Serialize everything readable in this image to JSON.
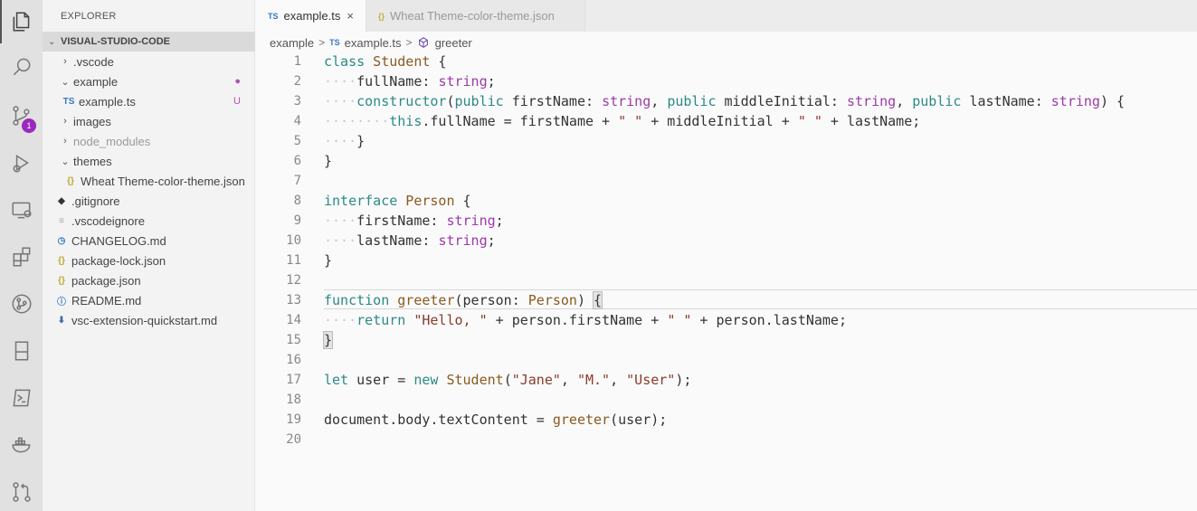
{
  "activity_bar": {
    "items": [
      {
        "icon": "files-icon",
        "active": true
      },
      {
        "icon": "search-icon"
      },
      {
        "icon": "source-control-icon",
        "badge": "1"
      },
      {
        "icon": "run-debug-icon"
      },
      {
        "icon": "remote-explorer-icon"
      },
      {
        "icon": "extensions-icon"
      },
      {
        "icon": "git-graph-icon"
      },
      {
        "icon": "bookmark-icon"
      },
      {
        "icon": "terminal-icon"
      },
      {
        "icon": "docker-icon"
      },
      {
        "icon": "pull-request-icon"
      }
    ]
  },
  "sidebar": {
    "title": "EXPLORER",
    "section": "VISUAL-STUDIO-CODE",
    "tree": [
      {
        "label": ".vscode",
        "twisty": "›",
        "indent": 1,
        "icon": ""
      },
      {
        "label": "example",
        "twisty": "⌄",
        "indent": 1,
        "icon": "",
        "decoration": "●",
        "modified": true
      },
      {
        "label": "example.ts",
        "twisty": "",
        "indent": 1,
        "icon": "TS",
        "decoration": "U",
        "modified": true
      },
      {
        "label": "images",
        "twisty": "›",
        "indent": 1,
        "icon": ""
      },
      {
        "label": "node_modules",
        "twisty": "›",
        "indent": 1,
        "icon": "",
        "dim": true
      },
      {
        "label": "themes",
        "twisty": "⌄",
        "indent": 1,
        "icon": ""
      },
      {
        "label": "Wheat Theme-color-theme.json",
        "twisty": "",
        "indent": 2,
        "icon": "{}"
      },
      {
        "label": ".gitignore",
        "twisty": "",
        "indent": 0,
        "icon": "◆"
      },
      {
        "label": ".vscodeignore",
        "twisty": "",
        "indent": 0,
        "icon": "≡"
      },
      {
        "label": "CHANGELOG.md",
        "twisty": "",
        "indent": 0,
        "icon": "◷"
      },
      {
        "label": "package-lock.json",
        "twisty": "",
        "indent": 0,
        "icon": "{}"
      },
      {
        "label": "package.json",
        "twisty": "",
        "indent": 0,
        "icon": "{}"
      },
      {
        "label": "README.md",
        "twisty": "",
        "indent": 0,
        "icon": "ⓘ"
      },
      {
        "label": "vsc-extension-quickstart.md",
        "twisty": "",
        "indent": 0,
        "icon": "⬇"
      }
    ]
  },
  "tabs": [
    {
      "label": "example.ts",
      "icon": "TS",
      "active": true,
      "close": "×"
    },
    {
      "label": "Wheat Theme-color-theme.json",
      "icon": "{}",
      "active": false
    }
  ],
  "breadcrumb": {
    "folder": "example",
    "file": "example.ts",
    "file_icon": "TS",
    "symbol": "greeter",
    "separator": ">"
  },
  "editor": {
    "lines": [
      [
        [
          "k",
          "class"
        ],
        [
          "",
          ""
        ],
        [
          "c",
          " Student"
        ],
        [
          "",
          " {"
        ]
      ],
      [
        [
          "ws",
          "····"
        ],
        [
          "",
          "fullName: "
        ],
        [
          "t",
          "string"
        ],
        [
          "",
          ";"
        ]
      ],
      [
        [
          "ws",
          "····"
        ],
        [
          "k",
          "constructor"
        ],
        [
          "",
          "("
        ],
        [
          "k",
          "public"
        ],
        [
          "",
          " firstName: "
        ],
        [
          "t",
          "string"
        ],
        [
          "",
          ", "
        ],
        [
          "k",
          "public"
        ],
        [
          "",
          " middleInitial: "
        ],
        [
          "t",
          "string"
        ],
        [
          "",
          ", "
        ],
        [
          "k",
          "public"
        ],
        [
          "",
          " lastName: "
        ],
        [
          "t",
          "string"
        ],
        [
          "",
          ") {"
        ]
      ],
      [
        [
          "ws",
          "········"
        ],
        [
          "k",
          "this"
        ],
        [
          "",
          ".fullName = firstName + "
        ],
        [
          "s",
          "\" \""
        ],
        [
          "",
          " + middleInitial + "
        ],
        [
          "s",
          "\" \""
        ],
        [
          "",
          " + lastName;"
        ]
      ],
      [
        [
          "ws",
          "····"
        ],
        [
          "",
          "}"
        ]
      ],
      [
        [
          "",
          "}"
        ]
      ],
      [
        [
          "",
          ""
        ]
      ],
      [
        [
          "k",
          "interface"
        ],
        [
          "c",
          " Person"
        ],
        [
          "",
          " {"
        ]
      ],
      [
        [
          "ws",
          "····"
        ],
        [
          "",
          "firstName: "
        ],
        [
          "t",
          "string"
        ],
        [
          "",
          ";"
        ]
      ],
      [
        [
          "ws",
          "····"
        ],
        [
          "",
          "lastName: "
        ],
        [
          "t",
          "string"
        ],
        [
          "",
          ";"
        ]
      ],
      [
        [
          "",
          "}"
        ]
      ],
      [
        [
          "",
          ""
        ]
      ],
      [
        [
          "k",
          "function"
        ],
        [
          "c",
          " greeter"
        ],
        [
          "",
          "(person: "
        ],
        [
          "c",
          "Person"
        ],
        [
          "",
          ") "
        ],
        [
          "br",
          "{"
        ]
      ],
      [
        [
          "ws",
          "····"
        ],
        [
          "k",
          "return"
        ],
        [
          "",
          " "
        ],
        [
          "s",
          "\"Hello, \""
        ],
        [
          "",
          " + person.firstName + "
        ],
        [
          "s",
          "\" \""
        ],
        [
          "",
          " + person.lastName;"
        ]
      ],
      [
        [
          "br",
          "}"
        ]
      ],
      [
        [
          "",
          ""
        ]
      ],
      [
        [
          "k",
          "let"
        ],
        [
          "",
          " user = "
        ],
        [
          "k",
          "new"
        ],
        [
          "c",
          " Student"
        ],
        [
          "",
          "("
        ],
        [
          "s",
          "\"Jane\""
        ],
        [
          "",
          ", "
        ],
        [
          "s",
          "\"M.\""
        ],
        [
          "",
          ", "
        ],
        [
          "s",
          "\"User\""
        ],
        [
          "",
          ");"
        ]
      ],
      [
        [
          "",
          ""
        ]
      ],
      [
        [
          "",
          "document"
        ],
        [
          "",
          ".body.textContent = "
        ],
        [
          "c",
          "greeter"
        ],
        [
          "",
          "(user);"
        ]
      ],
      [
        [
          "",
          ""
        ]
      ]
    ]
  }
}
